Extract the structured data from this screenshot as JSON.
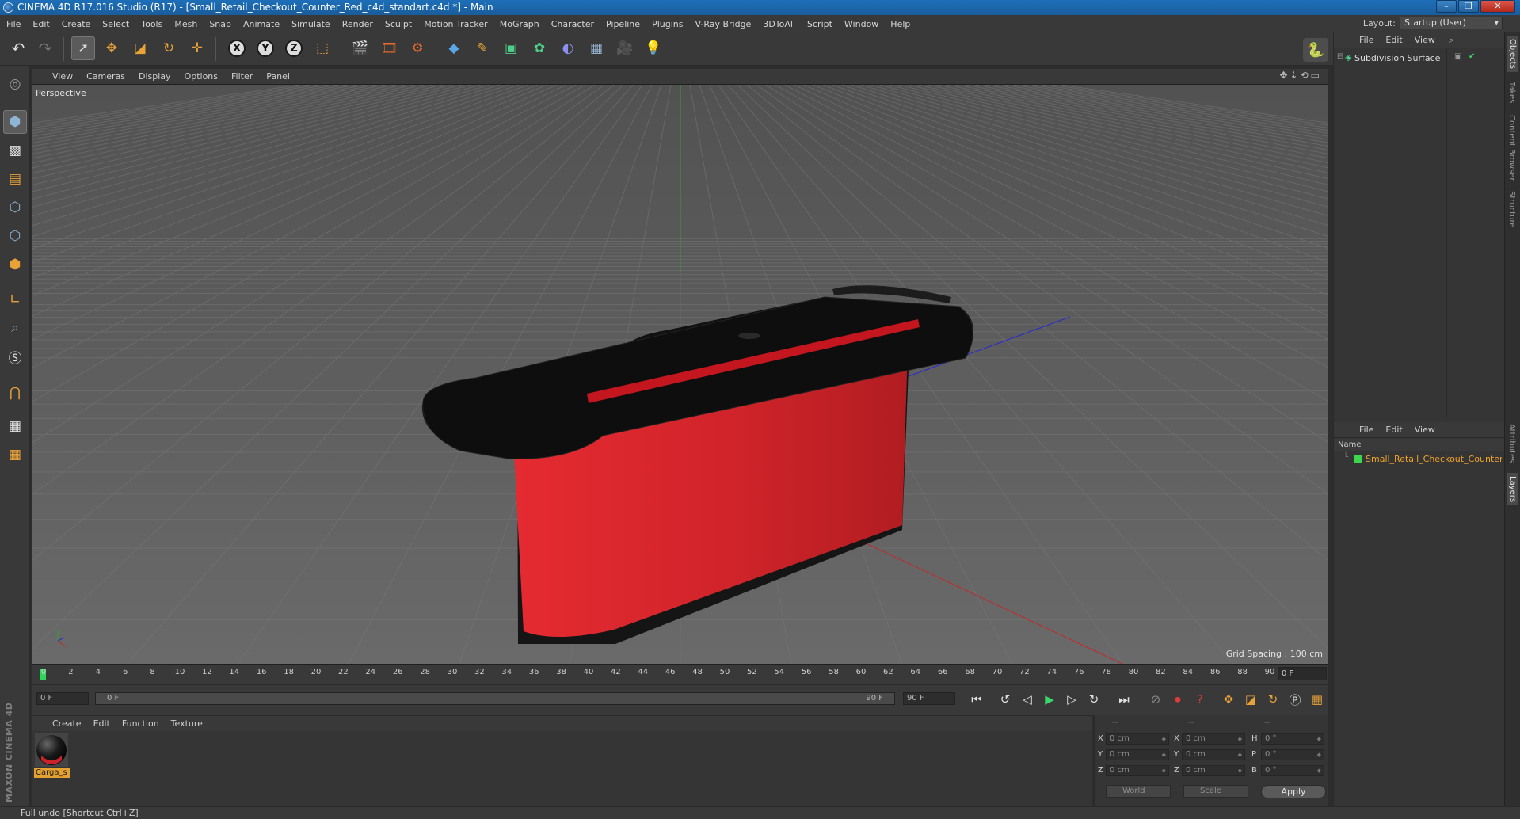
{
  "window": {
    "title": "CINEMA 4D R17.016 Studio (R17) - [Small_Retail_Checkout_Counter_Red_c4d_standart.c4d *] - Main",
    "controls": [
      "–",
      "❐",
      "✕"
    ]
  },
  "menubar": {
    "items": [
      "File",
      "Edit",
      "Create",
      "Select",
      "Tools",
      "Mesh",
      "Snap",
      "Animate",
      "Simulate",
      "Render",
      "Sculpt",
      "Motion Tracker",
      "MoGraph",
      "Character",
      "Pipeline",
      "Plugins",
      "V-Ray Bridge",
      "3DToAll",
      "Script",
      "Window",
      "Help"
    ],
    "layout_label": "Layout:",
    "layout_value": "Startup (User)"
  },
  "toolbar": {
    "icons": [
      "undo-icon",
      "redo-icon",
      "select-tool-icon",
      "move-tool-icon",
      "scale-tool-icon",
      "rotate-tool-icon",
      "last-tool-icon",
      "x-axis-lock-icon",
      "y-axis-lock-icon",
      "z-axis-lock-icon",
      "coordinate-system-icon",
      "render-view-icon",
      "render-picture-viewer-icon",
      "render-settings-icon",
      "cube-primitive-icon",
      "pen-spline-icon",
      "subdivision-surface-icon",
      "array-icon",
      "deformer-icon",
      "floor-icon",
      "camera-icon",
      "light-icon"
    ],
    "axis_letters": [
      "X",
      "Y",
      "Z"
    ]
  },
  "left_toolbar": {
    "icons": [
      "make-editable-icon",
      "model-mode-icon",
      "texture-mode-icon",
      "workplane-icon",
      "points-mode-icon",
      "edges-mode-icon",
      "polygons-mode-icon",
      "axis-mode-icon",
      "tweak-mode-icon",
      "solo-icon",
      "snapping-magnet-icon",
      "workplane-lock-icon",
      "animation-snap-icon"
    ],
    "brand": "MAXON CINEMA 4D"
  },
  "viewport": {
    "menu": [
      "View",
      "Cameras",
      "Display",
      "Options",
      "Filter",
      "Panel"
    ],
    "name": "Perspective",
    "grid_spacing": "Grid Spacing : 100 cm",
    "colors": {
      "background": "#5d5d5d",
      "grid": "#6b6b6b",
      "counter_red": "#c8232a",
      "counter_black": "#111111"
    }
  },
  "timeline": {
    "ticks": [
      "0",
      "2",
      "4",
      "6",
      "8",
      "10",
      "12",
      "14",
      "16",
      "18",
      "20",
      "22",
      "24",
      "26",
      "28",
      "30",
      "32",
      "34",
      "36",
      "38",
      "40",
      "42",
      "44",
      "46",
      "48",
      "50",
      "52",
      "54",
      "56",
      "58",
      "60",
      "62",
      "64",
      "66",
      "68",
      "70",
      "72",
      "74",
      "76",
      "78",
      "80",
      "82",
      "84",
      "86",
      "88",
      "90"
    ],
    "current_frame": "0 F"
  },
  "playback": {
    "start_frame": "0 F",
    "range_start": "0 F",
    "range_end": "90 F",
    "end_frame": "90 F"
  },
  "material_manager": {
    "menu": [
      "Create",
      "Edit",
      "Function",
      "Texture"
    ],
    "material_label": "Carga_s"
  },
  "coordinates": {
    "header": [
      "--",
      "--",
      "--"
    ],
    "rows": [
      {
        "a": "X",
        "av": "0 cm",
        "b": "X",
        "bv": "0 cm",
        "c": "H",
        "cv": "0 °"
      },
      {
        "a": "Y",
        "av": "0 cm",
        "b": "Y",
        "bv": "0 cm",
        "c": "P",
        "cv": "0 °"
      },
      {
        "a": "Z",
        "av": "0 cm",
        "b": "Z",
        "bv": "0 cm",
        "c": "B",
        "cv": "0 °"
      }
    ],
    "mode1": "World",
    "mode2": "Scale",
    "apply": "Apply"
  },
  "object_manager": {
    "menu": [
      "File",
      "Edit",
      "View"
    ],
    "object_name": "Subdivision Surface"
  },
  "layer_manager": {
    "menu": [
      "File",
      "Edit",
      "View"
    ],
    "column_header": "Name",
    "layer_name": "Small_Retail_Checkout_Counter_R"
  },
  "right_tabs": [
    "Objects",
    "Takes",
    "Content Browser",
    "Structure",
    "Attributes",
    "Layers"
  ],
  "status": "Full undo [Shortcut Ctrl+Z]"
}
